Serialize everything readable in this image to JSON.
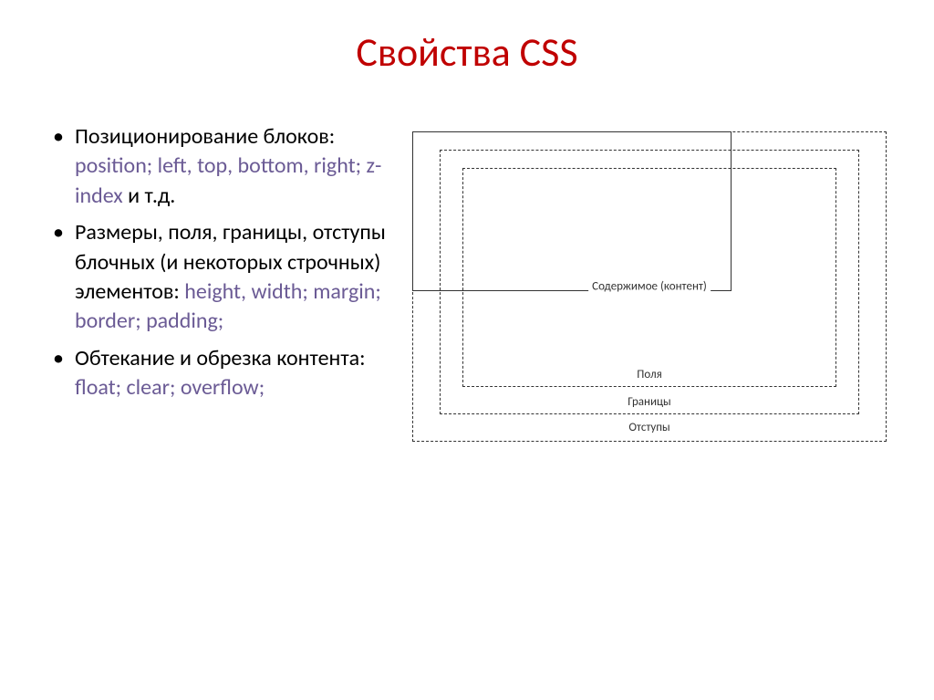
{
  "title": "Свойства CSS",
  "bullets": [
    {
      "lead": "Позиционирование блоков: ",
      "keywords": "position; left, top, bottom, right; z-index ",
      "trail": "и т.д."
    },
    {
      "lead": "Размеры, поля, границы, отступы блочных (и некоторых строчных) элементов: ",
      "keywords": "height, width; margin; border; padding;",
      "trail": ""
    },
    {
      "lead": "Обтекание и обрезка контента: ",
      "keywords": "float; clear; overflow;",
      "trail": ""
    }
  ],
  "diagram": {
    "content": "Содержимое (контент)",
    "polya": "Поля",
    "granicy": "Границы",
    "otstupy": "Отступы"
  }
}
